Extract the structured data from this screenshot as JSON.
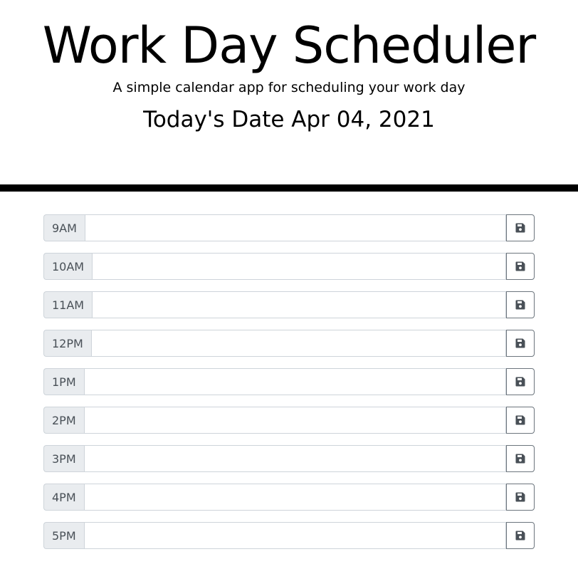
{
  "header": {
    "title": "Work Day Scheduler",
    "subtitle": "A simple calendar app for scheduling your work day",
    "date": "Today's Date Apr 04, 2021"
  },
  "schedule": {
    "rows": [
      {
        "hour": "9AM",
        "entry": ""
      },
      {
        "hour": "10AM",
        "entry": ""
      },
      {
        "hour": "11AM",
        "entry": ""
      },
      {
        "hour": "12PM",
        "entry": ""
      },
      {
        "hour": "1PM",
        "entry": ""
      },
      {
        "hour": "2PM",
        "entry": ""
      },
      {
        "hour": "3PM",
        "entry": ""
      },
      {
        "hour": "4PM",
        "entry": ""
      },
      {
        "hour": "5PM",
        "entry": ""
      }
    ],
    "save_icon": "floppy-disk-icon"
  },
  "colors": {
    "divider": "#000000",
    "hour_bg": "#e9ecef",
    "border": "#ced4da",
    "button_border": "#6c757d",
    "icon": "#495057"
  }
}
